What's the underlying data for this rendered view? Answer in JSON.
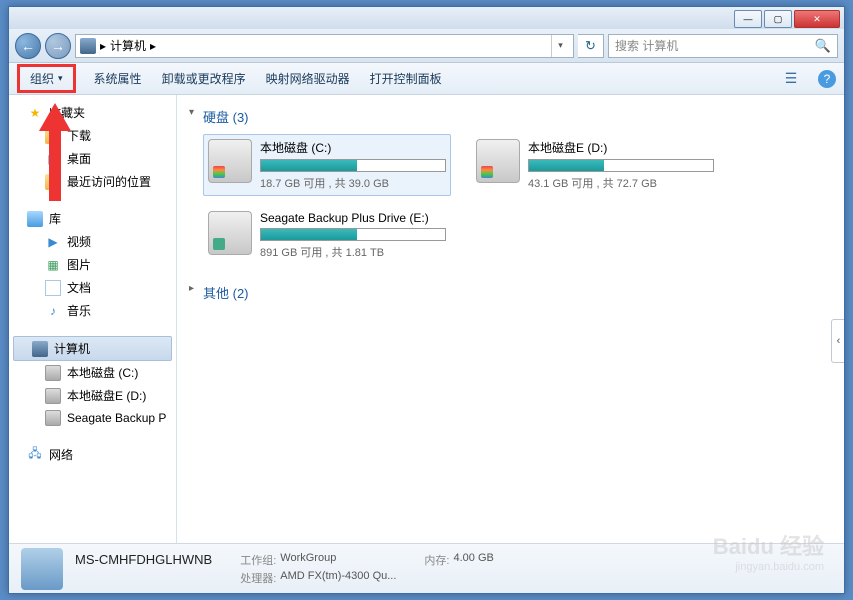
{
  "window": {
    "minimize": "—",
    "maximize": "▢",
    "close": "✕"
  },
  "nav": {
    "back": "←",
    "forward": "→",
    "path_label": "计算机",
    "path_arrow": "▸",
    "dropdown": "▾",
    "refresh": "↻"
  },
  "search": {
    "placeholder": "搜索 计算机",
    "icon": "🔍"
  },
  "toolbar": {
    "organize": "组织",
    "organize_arrow": "▾",
    "items": [
      "系统属性",
      "卸载或更改程序",
      "映射网络驱动器",
      "打开控制面板"
    ],
    "view_icon": "☰",
    "help_icon": "?"
  },
  "sidebar": {
    "favorites": {
      "label": "收藏夹",
      "items": [
        "下载",
        "桌面",
        "最近访问的位置"
      ]
    },
    "libraries": {
      "label": "库",
      "items": [
        "视频",
        "图片",
        "文档",
        "音乐"
      ]
    },
    "computer": {
      "label": "计算机",
      "items": [
        "本地磁盘 (C:)",
        "本地磁盘E (D:)",
        "Seagate Backup P"
      ]
    },
    "network": {
      "label": "网络"
    }
  },
  "content": {
    "hdd_header": "硬盘 (3)",
    "other_header": "其他 (2)",
    "drives": [
      {
        "name": "本地磁盘 (C:)",
        "stat": "18.7 GB 可用 , 共 39.0 GB",
        "pct": 52,
        "selected": true
      },
      {
        "name": "本地磁盘E (D:)",
        "stat": "43.1 GB 可用 , 共 72.7 GB",
        "pct": 41,
        "selected": false
      },
      {
        "name": "Seagate Backup Plus Drive (E:)",
        "stat": "891 GB 可用 , 共 1.81 TB",
        "pct": 52,
        "selected": false,
        "ext": true
      }
    ]
  },
  "statusbar": {
    "name": "MS-CMHFDHGLHWNB",
    "workgroup_label": "工作组:",
    "workgroup": "WorkGroup",
    "cpu_label": "处理器:",
    "cpu": "AMD FX(tm)-4300 Qu...",
    "mem_label": "内存:",
    "mem": "4.00 GB"
  },
  "watermark": {
    "main": "Baidu 经验",
    "sub": "jingyan.baidu.com"
  }
}
